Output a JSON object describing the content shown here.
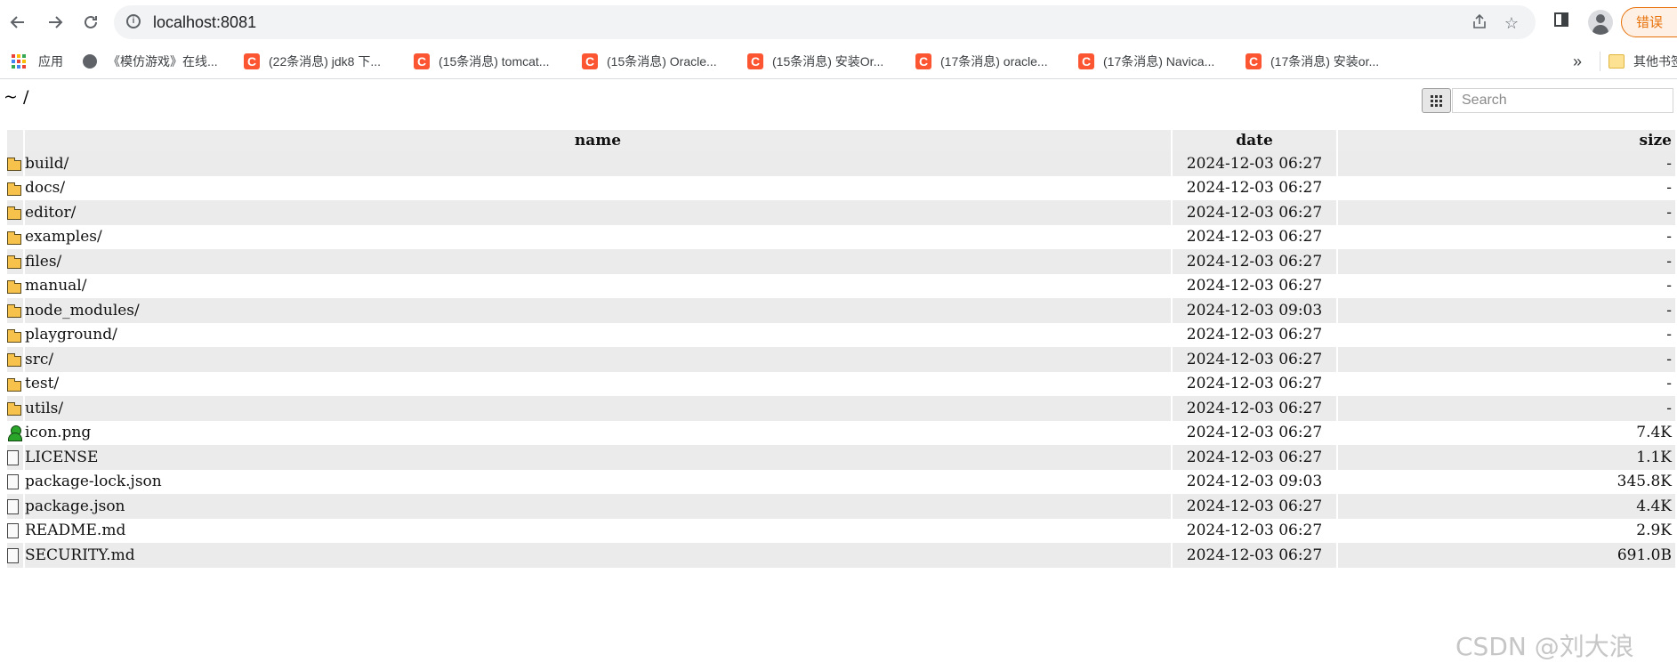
{
  "browser": {
    "url": "localhost:8081",
    "error_label": "错误"
  },
  "bookmarks": {
    "apps_label": "应用",
    "items": [
      {
        "label": "《模仿游戏》在线...",
        "icon": "globe-icon"
      },
      {
        "label": "(22条消息) jdk8 下...",
        "icon": "csdn-icon"
      },
      {
        "label": "(15条消息) tomcat...",
        "icon": "csdn-icon"
      },
      {
        "label": "(15条消息) Oracle...",
        "icon": "csdn-icon"
      },
      {
        "label": "(15条消息) 安装Or...",
        "icon": "csdn-icon"
      },
      {
        "label": "(17条消息) oracle...",
        "icon": "csdn-icon"
      },
      {
        "label": "(17条消息) Navica...",
        "icon": "csdn-icon"
      },
      {
        "label": "(17条消息) 安装or...",
        "icon": "csdn-icon"
      }
    ],
    "overflow_label": "»",
    "other_label": "其他书签"
  },
  "page": {
    "path": "~ /",
    "search_placeholder": "Search"
  },
  "table": {
    "headers": {
      "name": "name",
      "date": "date",
      "size": "size"
    },
    "rows": [
      {
        "name": "build/",
        "date": "2024-12-03 06:27",
        "size": "-",
        "type": "folder"
      },
      {
        "name": "docs/",
        "date": "2024-12-03 06:27",
        "size": "-",
        "type": "folder"
      },
      {
        "name": "editor/",
        "date": "2024-12-03 06:27",
        "size": "-",
        "type": "folder"
      },
      {
        "name": "examples/",
        "date": "2024-12-03 06:27",
        "size": "-",
        "type": "folder"
      },
      {
        "name": "files/",
        "date": "2024-12-03 06:27",
        "size": "-",
        "type": "folder"
      },
      {
        "name": "manual/",
        "date": "2024-12-03 06:27",
        "size": "-",
        "type": "folder"
      },
      {
        "name": "node_modules/",
        "date": "2024-12-03 09:03",
        "size": "-",
        "type": "folder"
      },
      {
        "name": "playground/",
        "date": "2024-12-03 06:27",
        "size": "-",
        "type": "folder"
      },
      {
        "name": "src/",
        "date": "2024-12-03 06:27",
        "size": "-",
        "type": "folder"
      },
      {
        "name": "test/",
        "date": "2024-12-03 06:27",
        "size": "-",
        "type": "folder"
      },
      {
        "name": "utils/",
        "date": "2024-12-03 06:27",
        "size": "-",
        "type": "folder"
      },
      {
        "name": "icon.png",
        "date": "2024-12-03 06:27",
        "size": "7.4K",
        "type": "image"
      },
      {
        "name": "LICENSE",
        "date": "2024-12-03 06:27",
        "size": "1.1K",
        "type": "file"
      },
      {
        "name": "package-lock.json",
        "date": "2024-12-03 09:03",
        "size": "345.8K",
        "type": "file"
      },
      {
        "name": "package.json",
        "date": "2024-12-03 06:27",
        "size": "4.4K",
        "type": "file"
      },
      {
        "name": "README.md",
        "date": "2024-12-03 06:27",
        "size": "2.9K",
        "type": "file"
      },
      {
        "name": "SECURITY.md",
        "date": "2024-12-03 06:27",
        "size": "691.0B",
        "type": "file"
      }
    ]
  },
  "watermark": "CSDN @刘大浪",
  "colors": {
    "csdn_red": "#fc5531",
    "error_orange": "#e8710a",
    "row_stripe": "#ebebeb",
    "folder_yellow": "#f7c24b"
  }
}
